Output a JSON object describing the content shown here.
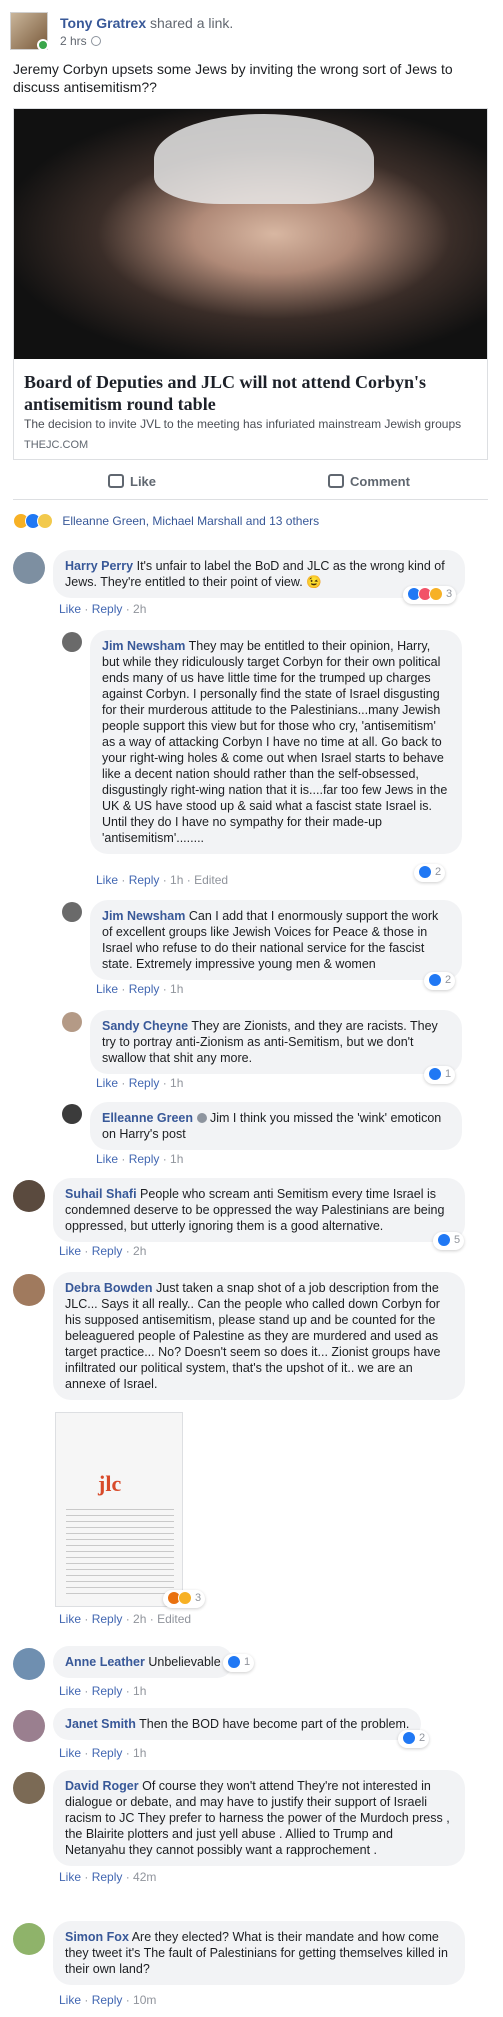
{
  "post": {
    "author": "Tony Gratrex",
    "action": "shared a link.",
    "time": "2 hrs",
    "text": "Jeremy Corbyn upsets some Jews by inviting the wrong sort of Jews to discuss antisemitism??",
    "link": {
      "title": "Board of Deputies and JLC will not attend Corbyn's antisemitism round table",
      "description": "The decision to invite JVL to the meeting has infuriated mainstream Jewish groups",
      "domain": "THEJC.COM"
    },
    "actions": {
      "like": "Like",
      "comment": "Comment"
    },
    "reactions": {
      "text": "Elleanne Green, Michael Marshall and 13 others"
    }
  },
  "comments": [
    {
      "name": "Harry Perry",
      "text": "It's unfair to label the BoD and JLC as the wrong kind of Jews. They're entitled to their point of view. 😉",
      "like": "Like",
      "reply": "Reply",
      "time": "2h",
      "reaction_count": "3"
    },
    {
      "name": "Jim Newsham",
      "text": "They may be entitled to their opinion, Harry, but while they ridiculously target Corbyn for their own political ends many of us have little time for the trumped up charges against Corbyn. I personally find the state of Israel disgusting for their murderous attitude to the Palestinians...many Jewish people support this view but for those who cry, 'antisemitism' as a way of attacking Corbyn I have no time at all. Go back to your right-wing holes & come out when Israel starts to behave like a decent nation should rather than the self-obsessed, disgustingly right-wing nation that it is....far too few Jews in the UK & US have stood up & said what a fascist state Israel is. Until they do I have no sympathy for their made-up 'antisemitism'........",
      "like": "Like",
      "reply": "Reply",
      "time": "1h",
      "edited": "Edited",
      "reaction_count": "2"
    },
    {
      "name": "Jim Newsham",
      "text": "Can I add that I enormously support the work of excellent groups like Jewish Voices for Peace & those in Israel who refuse to do their national service for the fascist state. Extremely impressive young men & women",
      "like": "Like",
      "reply": "Reply",
      "time": "1h",
      "reaction_count": "2"
    },
    {
      "name": "Sandy Cheyne",
      "text": "They are Zionists, and they are racists. They try to portray anti-Zionism as anti-Semitism, but we don't swallow that shit any more.",
      "like": "Like",
      "reply": "Reply",
      "time": "1h",
      "reaction_count": "1"
    },
    {
      "name": "Elleanne Green",
      "text": "Jim I think you missed the 'wink' emoticon on Harry's post",
      "like": "Like",
      "reply": "Reply",
      "time": "1h"
    },
    {
      "name": "Suhail Shafi",
      "text": "People who scream anti Semitism every time Israel is condemned deserve to be oppressed the way Palestinians are being oppressed, but utterly ignoring them is a good alternative.",
      "like": "Like",
      "reply": "Reply",
      "time": "2h",
      "reaction_count": "5"
    },
    {
      "name": "Debra Bowden",
      "text": "Just taken a snap shot of a job description from the JLC... Says it all really.. Can the people who called down Corbyn for his supposed antisemitism, please stand up and be counted for the beleaguered people of Palestine as they are murdered and used as target practice... No? Doesn't seem so does it... Zionist groups have infiltrated our political system, that's the upshot of it.. we are an annexe of Israel.",
      "like": "Like",
      "reply": "Reply",
      "time": "2h",
      "edited": "Edited",
      "reaction_count": "3",
      "image_logo": "jlc"
    },
    {
      "name": "Anne Leather",
      "text": "Unbelievable",
      "like": "Like",
      "reply": "Reply",
      "time": "1h",
      "reaction_count": "1"
    },
    {
      "name": "Janet Smith",
      "text": "Then the BOD have become part of the problem.",
      "like": "Like",
      "reply": "Reply",
      "time": "1h",
      "reaction_count": "2"
    },
    {
      "name": "David Roger",
      "text": "Of course they won't attend They're not interested in dialogue or debate, and may have to justify their support of Israeli racism to JC They prefer to harness the power of the Murdoch press , the Blairite plotters and just yell abuse . Allied to Trump and Netanyahu they cannot possibly want a rapprochement .",
      "like": "Like",
      "reply": "Reply",
      "time": "42m"
    },
    {
      "name": "Simon Fox",
      "text": "Are they elected? What is their mandate and how come they tweet it's The fault of Palestinians for getting themselves killed in their own land?",
      "like": "Like",
      "reply": "Reply",
      "time": "10m"
    }
  ]
}
